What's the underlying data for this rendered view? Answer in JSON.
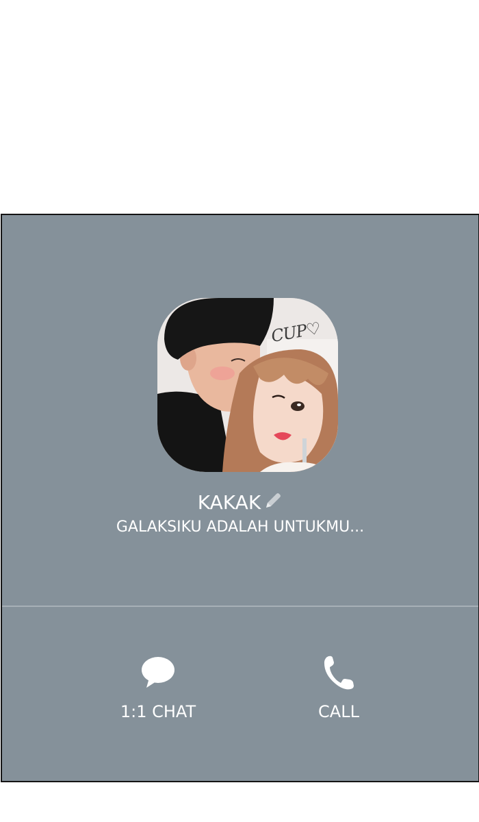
{
  "profile": {
    "name": "KAKAK",
    "status_message": "GALAKSIKU ADALAH UNTUKMU...",
    "photo_caption": "CUP♡",
    "edit_icon": "pencil-icon"
  },
  "actions": {
    "chat": {
      "label": "1:1 CHAT",
      "icon": "chat-bubble-icon"
    },
    "call": {
      "label": "CALL",
      "icon": "phone-icon"
    }
  },
  "colors": {
    "panel_background": "#85919a",
    "text": "#ffffff"
  }
}
